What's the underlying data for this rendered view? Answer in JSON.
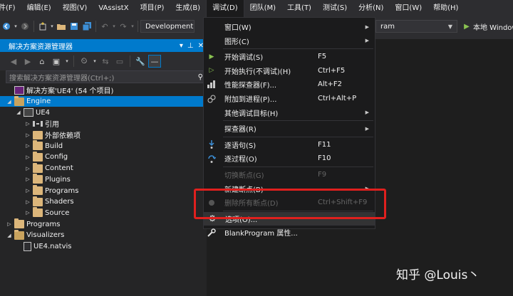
{
  "menubar": {
    "items": [
      {
        "label": "件(F)"
      },
      {
        "label": "编辑(E)"
      },
      {
        "label": "视图(V)"
      },
      {
        "label": "VAssistX"
      },
      {
        "label": "项目(P)"
      },
      {
        "label": "生成(B)"
      },
      {
        "label": "调试(D)"
      },
      {
        "label": "团队(M)"
      },
      {
        "label": "工具(T)"
      },
      {
        "label": "测试(S)"
      },
      {
        "label": "分析(N)"
      },
      {
        "label": "窗口(W)"
      },
      {
        "label": "帮助(H)"
      }
    ]
  },
  "toolbar": {
    "config_combo": "Development E",
    "startup_combo": "ram",
    "run_label": "本地 Window"
  },
  "solution_explorer": {
    "title": "解决方案资源管理器",
    "search_placeholder": "搜索解决方案资源管理器(Ctrl+;)",
    "tree": [
      {
        "label": "解决方案'UE4' (54 个项目)",
        "level": 0,
        "icon": "solution-icon",
        "arrow": ""
      },
      {
        "label": "Engine",
        "level": 0,
        "icon": "folder-open-icon",
        "arrow": "expanded",
        "selected": true
      },
      {
        "label": "UE4",
        "level": 1,
        "icon": "project-icon",
        "arrow": "expanded"
      },
      {
        "label": "引用",
        "level": 2,
        "icon": "references-icon",
        "arrow": "collapsed"
      },
      {
        "label": "外部依赖项",
        "level": 2,
        "icon": "external-dependencies-icon",
        "arrow": "collapsed"
      },
      {
        "label": "Build",
        "level": 2,
        "icon": "folder-icon",
        "arrow": "collapsed"
      },
      {
        "label": "Config",
        "level": 2,
        "icon": "folder-icon",
        "arrow": "collapsed"
      },
      {
        "label": "Content",
        "level": 2,
        "icon": "folder-icon",
        "arrow": "collapsed"
      },
      {
        "label": "Plugins",
        "level": 2,
        "icon": "folder-icon",
        "arrow": "collapsed"
      },
      {
        "label": "Programs",
        "level": 2,
        "icon": "folder-icon",
        "arrow": "collapsed"
      },
      {
        "label": "Shaders",
        "level": 2,
        "icon": "folder-icon",
        "arrow": "collapsed"
      },
      {
        "label": "Source",
        "level": 2,
        "icon": "folder-icon",
        "arrow": "collapsed"
      },
      {
        "label": "Programs",
        "level": 0,
        "icon": "folder-icon",
        "arrow": "collapsed"
      },
      {
        "label": "Visualizers",
        "level": 0,
        "icon": "folder-open-icon",
        "arrow": "expanded"
      },
      {
        "label": "UE4.natvis",
        "level": 1,
        "icon": "file-icon",
        "arrow": ""
      }
    ]
  },
  "debug_menu": {
    "items": [
      {
        "label": "窗口(W)",
        "shortcut": "",
        "submenu": true,
        "icon": ""
      },
      {
        "label": "图形(C)",
        "shortcut": "",
        "submenu": true,
        "icon": ""
      },
      {
        "separator": true
      },
      {
        "label": "开始调试(S)",
        "shortcut": "F5",
        "submenu": false,
        "icon": "play-icon"
      },
      {
        "label": "开始执行(不调试)(H)",
        "shortcut": "Ctrl+F5",
        "submenu": false,
        "icon": "play-outline-icon"
      },
      {
        "label": "性能探查器(F)...",
        "shortcut": "Alt+F2",
        "submenu": false,
        "icon": "profiler-icon"
      },
      {
        "label": "附加到进程(P)...",
        "shortcut": "Ctrl+Alt+P",
        "submenu": false,
        "icon": "attach-icon"
      },
      {
        "label": "其他调试目标(H)",
        "shortcut": "",
        "submenu": true,
        "icon": ""
      },
      {
        "separator": true
      },
      {
        "label": "探查器(R)",
        "shortcut": "",
        "submenu": true,
        "icon": ""
      },
      {
        "separator": true
      },
      {
        "label": "逐语句(S)",
        "shortcut": "F11",
        "submenu": false,
        "icon": "step-into-icon"
      },
      {
        "label": "逐过程(O)",
        "shortcut": "F10",
        "submenu": false,
        "icon": "step-over-icon"
      },
      {
        "separator": true
      },
      {
        "label": "切换断点(G)",
        "shortcut": "F9",
        "submenu": false,
        "icon": "",
        "disabled": true
      },
      {
        "label": "新建断点(B)",
        "shortcut": "",
        "submenu": true,
        "icon": ""
      },
      {
        "label": "删除所有断点(D)",
        "shortcut": "Ctrl+Shift+F9",
        "submenu": false,
        "icon": "delete-breakpoints-icon",
        "disabled": true
      },
      {
        "separator": true
      },
      {
        "label": "选项(O)...",
        "shortcut": "",
        "submenu": false,
        "icon": "gear-icon",
        "highlight": true
      },
      {
        "label": "BlankProgram 属性...",
        "shortcut": "",
        "submenu": false,
        "icon": "wrench-icon"
      }
    ]
  },
  "watermark": "知乎 @Louis丶",
  "colors": {
    "accent": "#007acc",
    "annotation": "#e0201e",
    "menu_bg": "#1b1b1c",
    "folder": "#dcb67a"
  }
}
